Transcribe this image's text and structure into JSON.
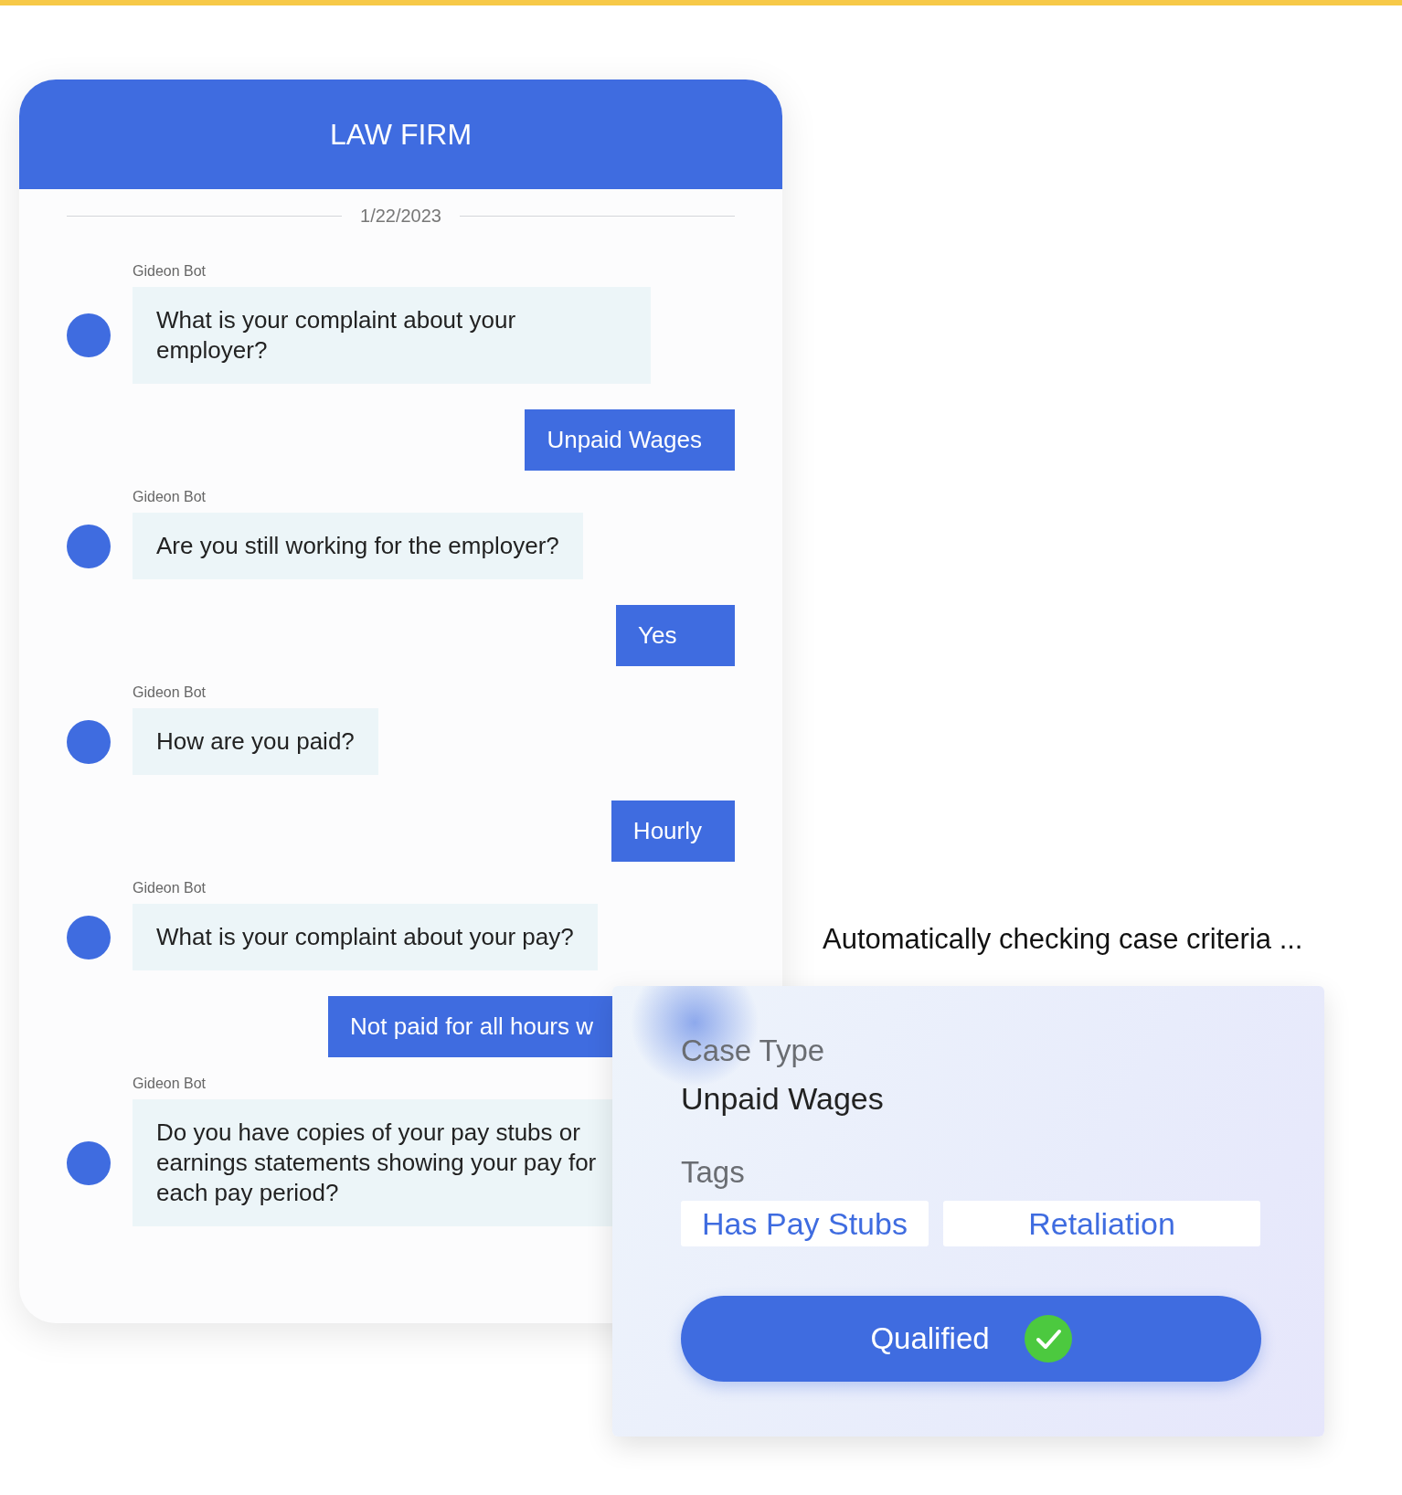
{
  "chat": {
    "title": "LAW FIRM",
    "date": "1/22/2023",
    "messages": [
      {
        "kind": "bot",
        "sender": "Gideon Bot",
        "text": "What is your complaint about your employer?"
      },
      {
        "kind": "user",
        "text": "Unpaid Wages",
        "partly_hidden": false
      },
      {
        "kind": "bot",
        "sender": "Gideon Bot",
        "text": "Are you still working for the employer?"
      },
      {
        "kind": "user",
        "text": "Yes",
        "partly_hidden": false
      },
      {
        "kind": "bot",
        "sender": "Gideon Bot",
        "text": "How are you paid?"
      },
      {
        "kind": "user",
        "text": "Hourly",
        "partly_hidden": false
      },
      {
        "kind": "bot",
        "sender": "Gideon Bot",
        "text": "What is your complaint about your pay?"
      },
      {
        "kind": "user",
        "text": "Not paid for all hours w",
        "partly_hidden": true
      },
      {
        "kind": "bot",
        "sender": "Gideon Bot",
        "text": "Do you have copies of your pay stubs or earnings statements showing your pay for each pay period?"
      }
    ]
  },
  "caption": "Automatically checking case criteria ...",
  "result_card": {
    "case_type_label": "Case Type",
    "case_type": "Unpaid Wages",
    "tags_label": "Tags",
    "tags": [
      "Has Pay Stubs",
      "Retaliation"
    ],
    "status": {
      "label": "Qualified",
      "checked": true
    }
  }
}
